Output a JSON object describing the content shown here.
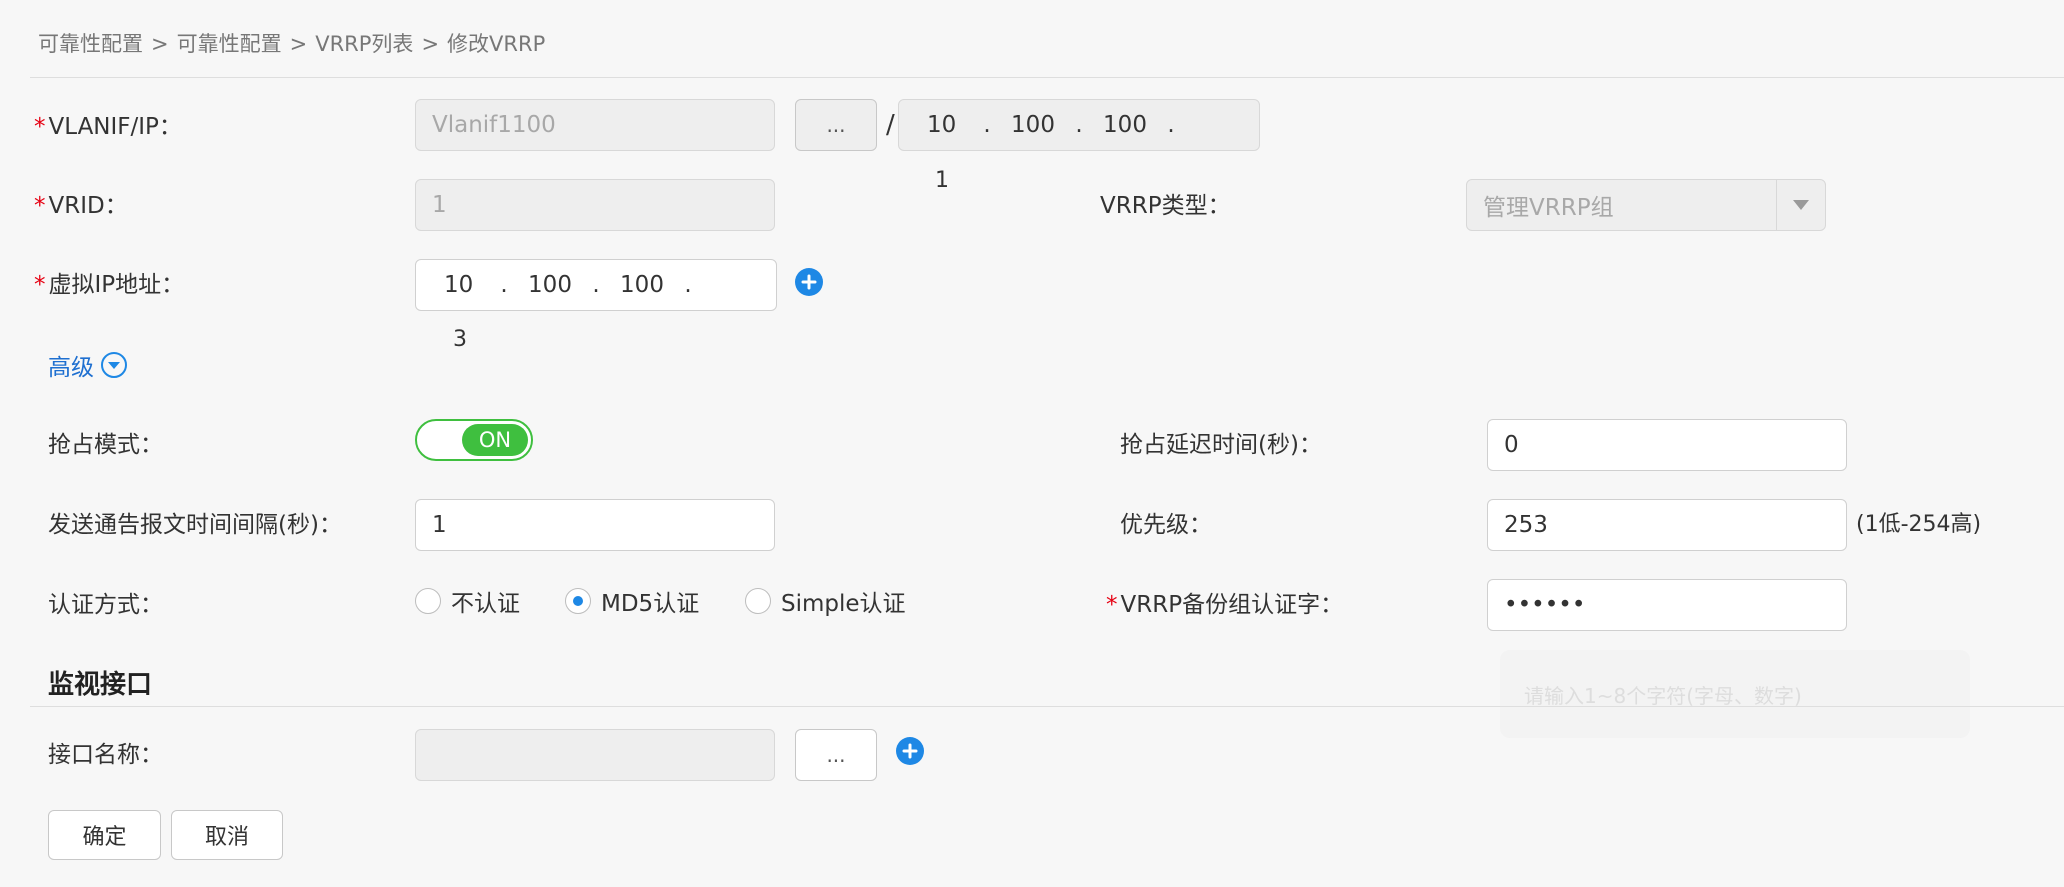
{
  "breadcrumb": [
    "可靠性配置",
    "可靠性配置",
    "VRRP列表",
    "修改VRRP"
  ],
  "breadcrumb_sep": ">",
  "form": {
    "vlanif_ip": {
      "label": "VLANIF/IP：",
      "value": "Vlanif1100",
      "pick_label": "...",
      "slash": "/",
      "ip": [
        "10",
        "100",
        "100",
        "1"
      ]
    },
    "vrid": {
      "label": "VRID：",
      "value": "1"
    },
    "vrrp_type": {
      "label": "VRRP类型：",
      "value": "管理VRRP组"
    },
    "virtual_ip": {
      "label": "虚拟IP地址：",
      "ip": [
        "10",
        "100",
        "100",
        "3"
      ]
    },
    "advanced": {
      "label": "高级"
    },
    "preempt_mode": {
      "label": "抢占模式：",
      "toggle": "ON"
    },
    "preempt_delay": {
      "label": "抢占延迟时间(秒)：",
      "value": "0"
    },
    "advert_interval": {
      "label": "发送通告报文时间间隔(秒)：",
      "value": "1"
    },
    "priority": {
      "label": "优先级：",
      "value": "253",
      "hint": "(1低-254高)"
    },
    "auth_mode": {
      "label": "认证方式：",
      "options": [
        "不认证",
        "MD5认证",
        "Simple认证"
      ],
      "selected": 1
    },
    "auth_key": {
      "label": "VRRP备份组认证字：",
      "value": "••••••"
    }
  },
  "monitor": {
    "title": "监视接口",
    "interface_label": "接口名称：",
    "interface_value": "",
    "pick_label": "..."
  },
  "actions": {
    "ok": "确定",
    "cancel": "取消"
  },
  "ghost_tip": "请输入1~8个字符(字母、数字)",
  "colors": {
    "accent": "#1e88e5",
    "toggle_on": "#3fbf3f",
    "required": "#e60012"
  }
}
